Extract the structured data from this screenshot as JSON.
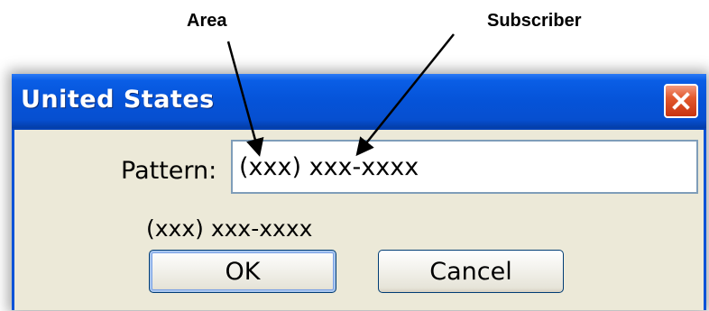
{
  "annotations": {
    "area_label": "Area",
    "subscriber_label": "Subscriber"
  },
  "window": {
    "title": "United States",
    "close_icon": "close-x-icon"
  },
  "form": {
    "pattern_label": "Pattern:",
    "pattern_value": "(xxx) xxx-xxxx",
    "preview": "(xxx) xxx-xxxx"
  },
  "buttons": {
    "ok_label": "OK",
    "cancel_label": "Cancel"
  },
  "colors": {
    "titlebar": "#0553d8",
    "dialog_background": "#ece9d8",
    "close_button": "#e2592e",
    "input_border": "#7f9db9"
  }
}
